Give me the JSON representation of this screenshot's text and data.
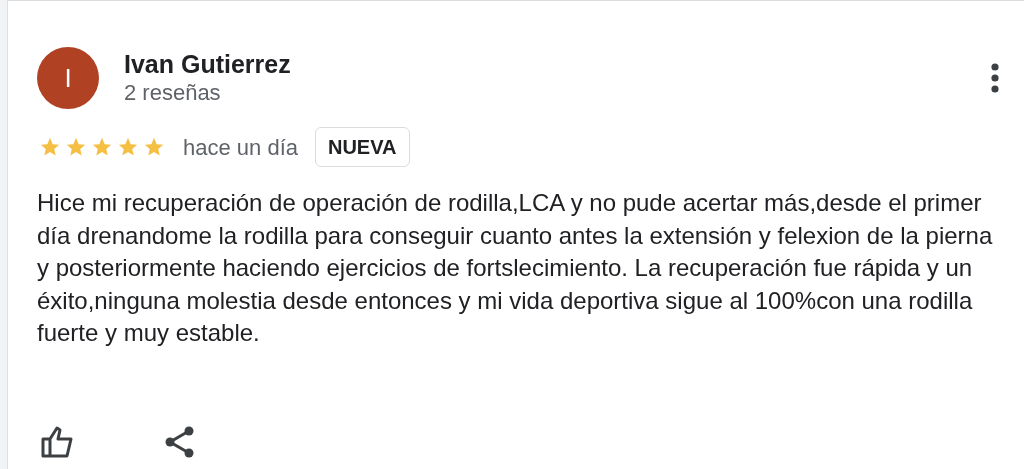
{
  "review": {
    "avatar_letter": "I",
    "author": "Ivan Gutierrez",
    "review_count": "2 reseñas",
    "stars": 5,
    "time": "hace un día",
    "badge": "NUEVA",
    "text": "Hice mi recuperación de operación de rodilla,LCA y no pude acertar más,desde el primer día drenandome la rodilla para conseguir cuanto antes la extensión y felexion de la pierna y posteriormente haciendo ejercicios de fortslecimiento. La recuperación fue rápida y un éxito,ninguna molestia desde entonces y mi vida deportiva sigue al 100%con una rodilla fuerte y muy estable."
  }
}
